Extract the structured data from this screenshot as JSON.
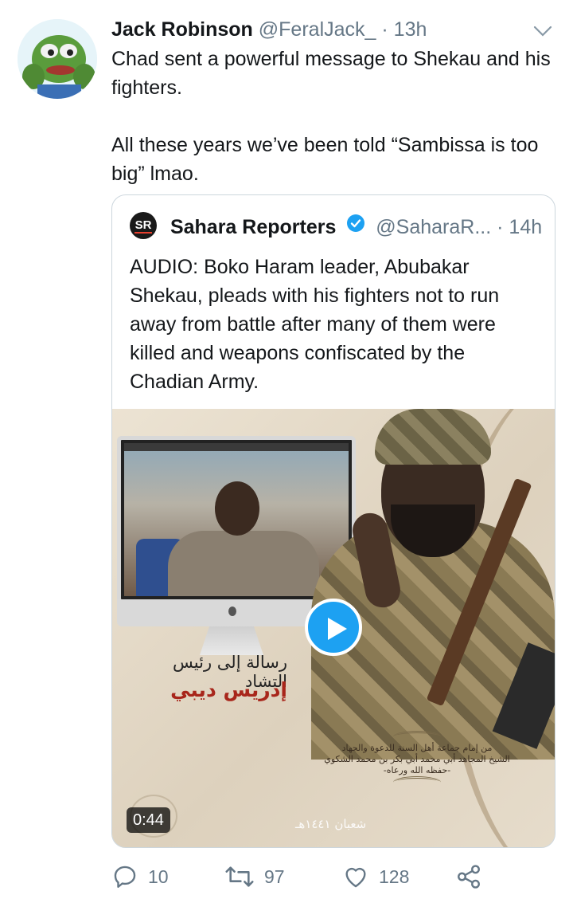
{
  "author": {
    "name": "Jack Robinson",
    "handle": "@FeralJack_",
    "separator": "·",
    "time": "13h"
  },
  "tweet": {
    "line1": "Chad sent a powerful message to Shekau and his fighters.",
    "line2": "All these years we’ve been told “Sambissa is too big” lmao."
  },
  "quoted": {
    "logo_text": "SR",
    "name": "Sahara Reporters",
    "verified": true,
    "handle": "@SaharaR...",
    "separator": "·",
    "time": "14h",
    "text": "AUDIO: Boko Haram leader, Abubakar Shekau, pleads with his fighters not to run away from battle after many of them were killed and weapons confiscated by the Chadian Army.",
    "media": {
      "type": "video",
      "duration": "0:44",
      "arabic_title_1": "رسالة إلى رئيس التشاد",
      "arabic_title_2": "إدريس ديبي",
      "cartouche_lines": [
        "من إمام جماعة أهل السنة للدعوة والجهاد",
        "الشيخ المجاهد أبي محمد أبي بكر بن محمد الشكوي",
        "-حفظه الله ورعاه-"
      ],
      "footer_arabic": "شعبان ١٤٤١هـ"
    }
  },
  "actions": {
    "replies": "10",
    "retweets": "97",
    "likes": "128"
  },
  "colors": {
    "accent": "#1da1f2",
    "secondary_text": "#657786",
    "verified": "#1da1f2"
  }
}
